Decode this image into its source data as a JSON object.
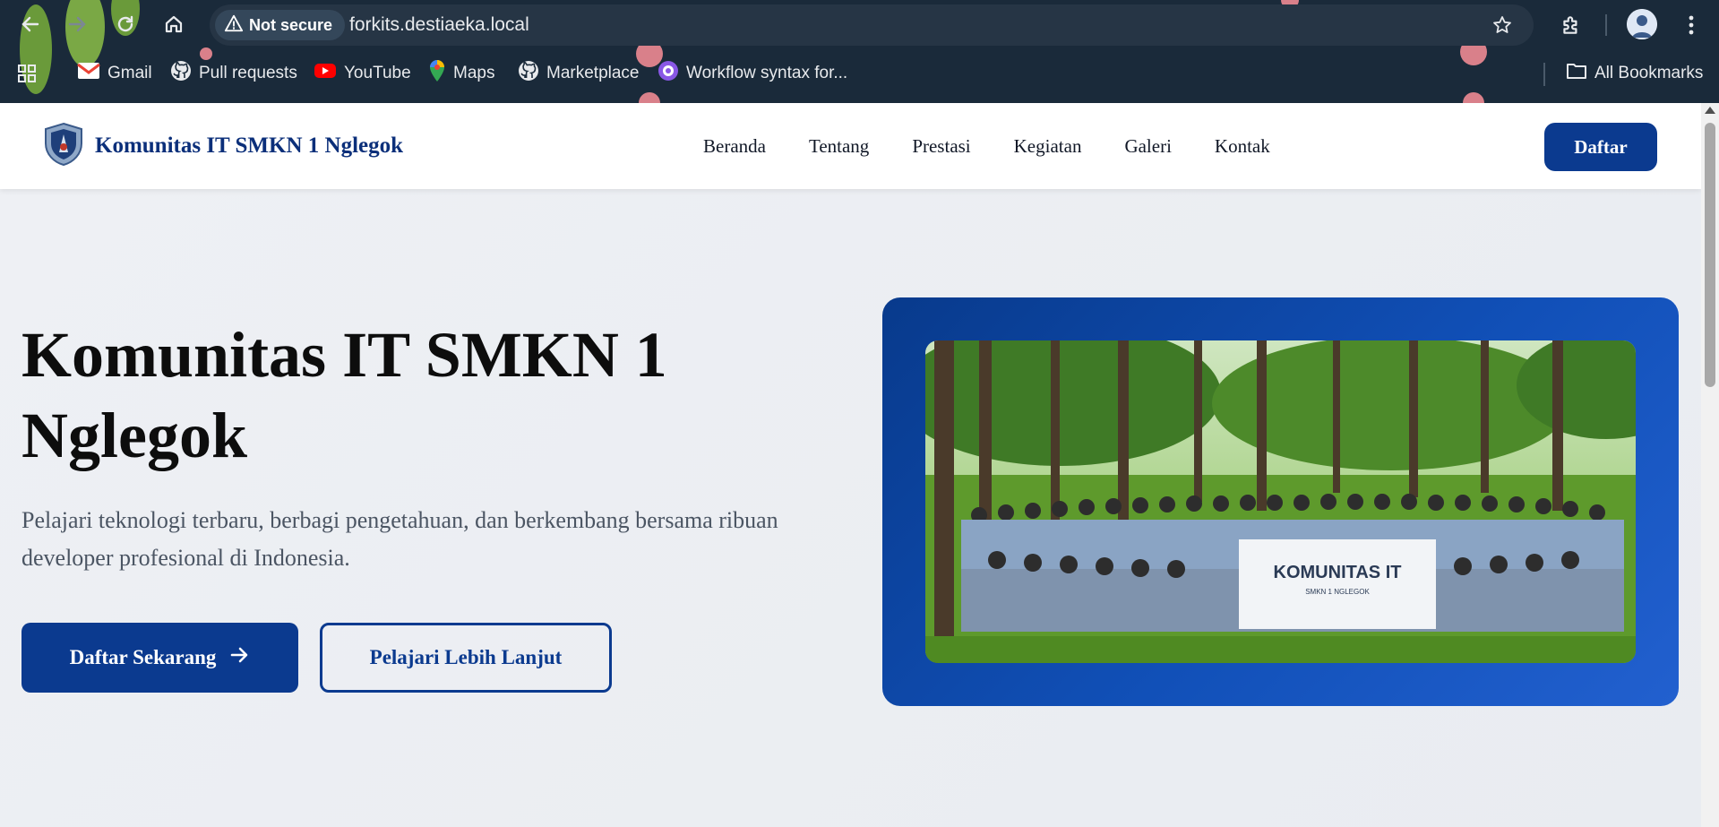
{
  "browser": {
    "security_label": "Not secure",
    "url": "forkits.destiaeka.local",
    "icons": [
      "back-icon",
      "forward-icon",
      "reload-icon",
      "home-icon",
      "warning-icon",
      "star-icon",
      "extensions-icon",
      "profile-avatar",
      "more-icon"
    ],
    "bookmarks": [
      {
        "label": "Gmail",
        "icon": "gmail-icon"
      },
      {
        "label": "Pull requests",
        "icon": "github-icon"
      },
      {
        "label": "YouTube",
        "icon": "youtube-icon"
      },
      {
        "label": "Maps",
        "icon": "maps-icon"
      },
      {
        "label": "Marketplace",
        "icon": "github-icon"
      },
      {
        "label": "Workflow syntax for...",
        "icon": "github-purple-icon"
      }
    ],
    "all_bookmarks": "All Bookmarks"
  },
  "site": {
    "brand": "Komunitas IT SMKN 1 Nglegok",
    "menu": [
      "Beranda",
      "Tentang",
      "Prestasi",
      "Kegiatan",
      "Galeri",
      "Kontak"
    ],
    "cta": "Daftar"
  },
  "hero": {
    "title_line1": "Komunitas IT SMKN 1",
    "title_line2": "Nglegok",
    "subtitle_line1": "Pelajari teknologi terbaru, berbagi pengetahuan, dan berkembang bersama ribuan",
    "subtitle_line2": "developer profesional di Indonesia.",
    "primary_button": "Daftar Sekarang",
    "secondary_button": "Pelajari Lebih Lanjut",
    "banner_text": "KOMUNITAS IT",
    "banner_subtext": "SMKN 1 NGLEGOK"
  },
  "colors": {
    "primary": "#0b3a8f",
    "brand_text": "#0b2f7a",
    "page_bg": "#eef0f4",
    "chrome_bg": "#1a2a3a"
  }
}
